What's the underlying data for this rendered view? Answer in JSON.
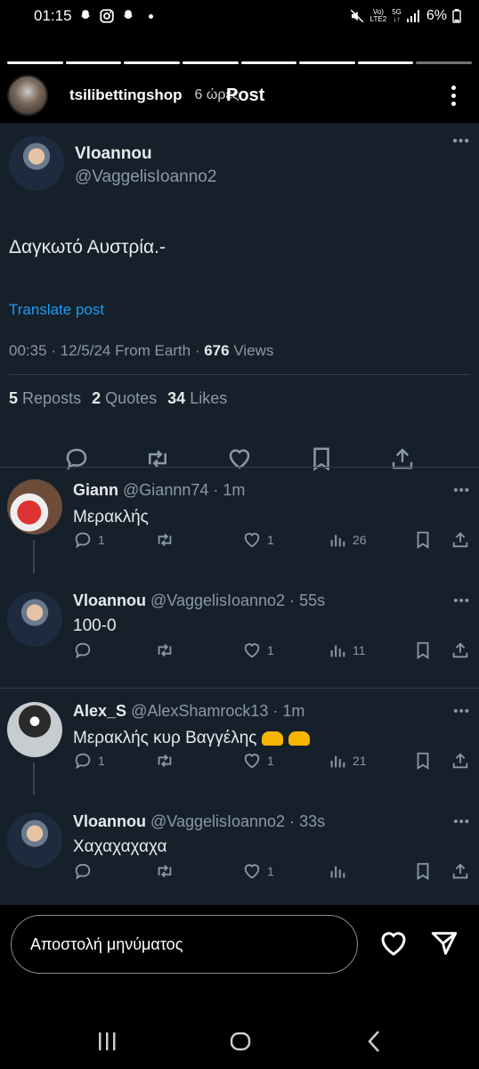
{
  "status_bar": {
    "time": "01:15",
    "battery": "6%",
    "network_top": "Vo)",
    "network_bottom": "LTE2",
    "five_g": "5G",
    "notification_icons": [
      "snapchat-icon",
      "instagram-icon",
      "snapchat-icon"
    ],
    "status_icons": [
      "mute-icon",
      "signal-icon",
      "battery-icon"
    ]
  },
  "story": {
    "username": "tsilibettingshop",
    "time_ago": "6 ώρες",
    "post_word": "Post",
    "segments": 8
  },
  "main_tweet": {
    "display_name": "Vloannou",
    "handle": "@VaggelisIoanno2",
    "text": "Δαγκωτό Αυστρία.-",
    "translate": "Translate post",
    "timestamp": "00:35 · 12/5/24 From Earth · ",
    "views_count": "676",
    "views_label": " Views",
    "reposts_count": "5",
    "reposts_label": "Reposts",
    "quotes_count": "2",
    "quotes_label": "Quotes",
    "likes_count": "34",
    "likes_label": "Likes"
  },
  "replies": [
    {
      "name": "Giann",
      "handle": "@Giannn74",
      "time": "1m",
      "text": "Μερακλής",
      "replies": "1",
      "reposts": "",
      "likes": "1",
      "views": "26"
    },
    {
      "name": "Vloannou",
      "handle": "@VaggelisIoanno2",
      "time": "55s",
      "text": "100-0",
      "replies": "",
      "reposts": "",
      "likes": "1",
      "views": "11"
    },
    {
      "name": "Alex_S",
      "handle": "@AlexShamrock13",
      "time": "1m",
      "text": "Μερακλής κυρ Βαγγέλης",
      "replies": "1",
      "reposts": "",
      "likes": "1",
      "views": "21"
    },
    {
      "name": "Vloannou",
      "handle": "@VaggelisIoanno2",
      "time": "33s",
      "text": "Χαχαχαχαχα",
      "replies": "",
      "reposts": "",
      "likes": "1",
      "views": ""
    }
  ],
  "message_bar": {
    "placeholder": "Αποστολή μηνύματος"
  },
  "colors": {
    "card_bg": "#15202b",
    "link": "#1d9bf0",
    "muted": "#8b98a5"
  }
}
